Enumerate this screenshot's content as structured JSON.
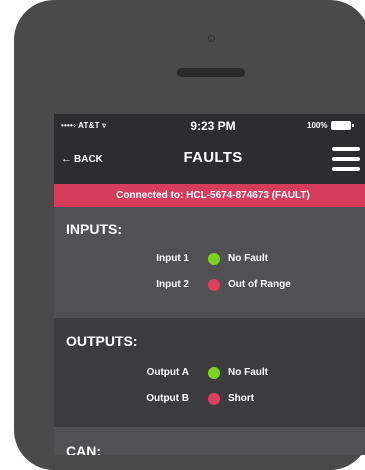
{
  "status_bar": {
    "carrier": "••••◦ AT&T ▿",
    "time": "9:23 PM",
    "battery": "100%"
  },
  "nav": {
    "back_label": "BACK",
    "title": "FAULTS"
  },
  "connection": {
    "text": "Connected to: HCL-5674-874673 (FAULT)"
  },
  "colors": {
    "ok": "#7ed321",
    "fault": "#e0405e",
    "accent_bar": "#d63d5c"
  },
  "sections": {
    "inputs": {
      "title": "INPUTS:",
      "rows": [
        {
          "label": "Input 1",
          "status": "No Fault",
          "state": "ok"
        },
        {
          "label": "Input 2",
          "status": "Out of Range",
          "state": "fault"
        }
      ]
    },
    "outputs": {
      "title": "OUTPUTS:",
      "rows": [
        {
          "label": "Output A",
          "status": "No Fault",
          "state": "ok"
        },
        {
          "label": "Output B",
          "status": "Short",
          "state": "fault"
        }
      ]
    },
    "can": {
      "title": "CAN:"
    }
  }
}
